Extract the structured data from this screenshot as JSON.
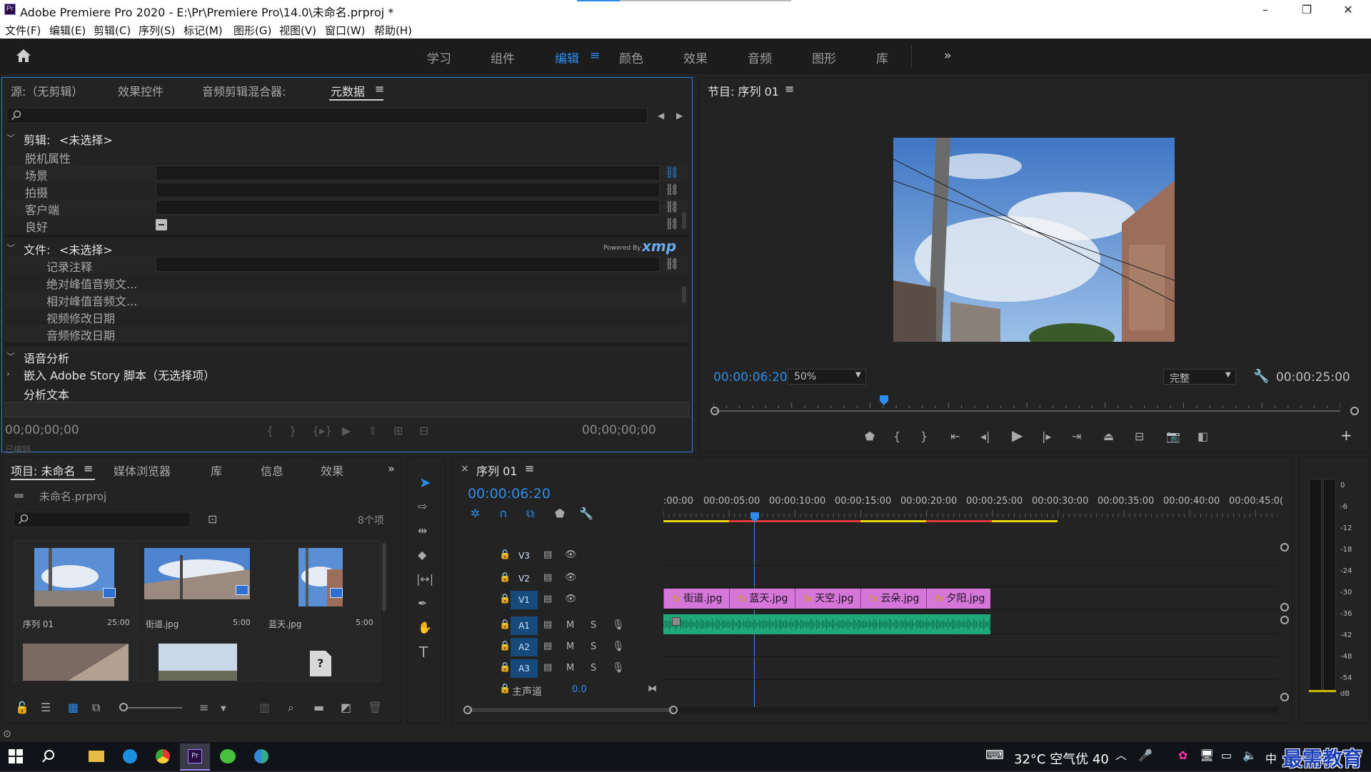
{
  "window": {
    "title": "Adobe Premiere Pro 2020 - E:\\Pr\\Premiere Pro\\14.0\\未命名.prproj *",
    "logo_text": "Pr",
    "minimize": "–",
    "maximize": "❐",
    "close": "✕"
  },
  "menu": [
    "文件(F)",
    "编辑(E)",
    "剪辑(C)",
    "序列(S)",
    "标记(M)",
    "图形(G)",
    "视图(V)",
    "窗口(W)",
    "帮助(H)"
  ],
  "workspaces": {
    "home_icon": "home-icon",
    "items": [
      "学习",
      "组件",
      "编辑",
      "颜色",
      "效果",
      "音频",
      "图形",
      "库"
    ],
    "active": "编辑",
    "menu_glyph": "≡",
    "more": "»"
  },
  "source_panel": {
    "tabs": [
      "源:（无剪辑）",
      "效果控件",
      "音频剪辑混合器:",
      "元数据"
    ],
    "active_tab": "元数据",
    "tab_menu": "≡",
    "sections": {
      "clip": {
        "label": "剪辑:",
        "value": "<未选择>",
        "rows": [
          "脱机属性",
          "场景",
          "拍摄",
          "客户端",
          "良好"
        ]
      },
      "file": {
        "label": "文件:",
        "value": "<未选择>",
        "powered": "Powered By",
        "xmp": "xmp",
        "rows": [
          "记录注释",
          "绝对峰值音频文...",
          "相对峰值音频文...",
          "视频修改日期",
          "音频修改日期"
        ]
      },
      "speech": "语音分析",
      "embed": "嵌入 Adobe Story 脚本（无选择项）",
      "analyze": "分析文本"
    },
    "timecode_left": "00;00;00;00",
    "timecode_right": "00;00;00;00",
    "ghost": "已编辑"
  },
  "program_panel": {
    "title": "节目: 序列 01",
    "tab_menu": "≡",
    "timecode": "00:00:06:20",
    "zoom": "50%",
    "quality": "完整",
    "duration": "00:00:25:00",
    "playhead_fraction": 0.272,
    "add": "+"
  },
  "project_panel": {
    "tabs": [
      "项目: 未命名",
      "媒体浏览器",
      "库",
      "信息",
      "效果"
    ],
    "active_tab": "项目: 未命名",
    "tab_menu": "≡",
    "more": "»",
    "file": "未命名.prproj",
    "count": "8个项",
    "items": [
      {
        "name": "序列 01",
        "dur": "25:00"
      },
      {
        "name": "街道.jpg",
        "dur": "5:00"
      },
      {
        "name": "蓝天.jpg",
        "dur": "5:00"
      }
    ],
    "missing": "?"
  },
  "timeline": {
    "close": "×",
    "title": "序列 01",
    "tab_menu": "≡",
    "timecode": "00:00:06:20",
    "ruler": [
      ":00:00",
      "00:00:05:00",
      "00:00:10:00",
      "00:00:15:00",
      "00:00:20:00",
      "00:00:25:00",
      "00:00:30:00",
      "00:00:35:00",
      "00:00:40:00",
      "00:00:45:0("
    ],
    "video_tracks": [
      "V3",
      "V2",
      "V1"
    ],
    "audio_tracks": [
      "A1",
      "A2",
      "A3"
    ],
    "mute": "M",
    "solo": "S",
    "master": {
      "label": "主声道",
      "value": "0.0"
    },
    "clips": [
      {
        "name": "街道.jpg",
        "fx": "fx"
      },
      {
        "name": "蓝天.jpg",
        "fx": "fx"
      },
      {
        "name": "天空.jpg",
        "fx": "fx"
      },
      {
        "name": "云朵.jpg",
        "fx": "fx"
      },
      {
        "name": "夕阳.jpg",
        "fx": "fx"
      }
    ]
  },
  "meter": {
    "scale": [
      "0",
      "-6",
      "-12",
      "-18",
      "-24",
      "-30",
      "-36",
      "-42",
      "-48",
      "-54",
      "dB"
    ]
  },
  "taskbar": {
    "weather": "32°C 空气优 40",
    "ime": "中",
    "watermark": "最需教育"
  },
  "colors": {
    "accent": "#2d8ceb",
    "clip": "#d577d9",
    "audio": "#1fa87a"
  }
}
